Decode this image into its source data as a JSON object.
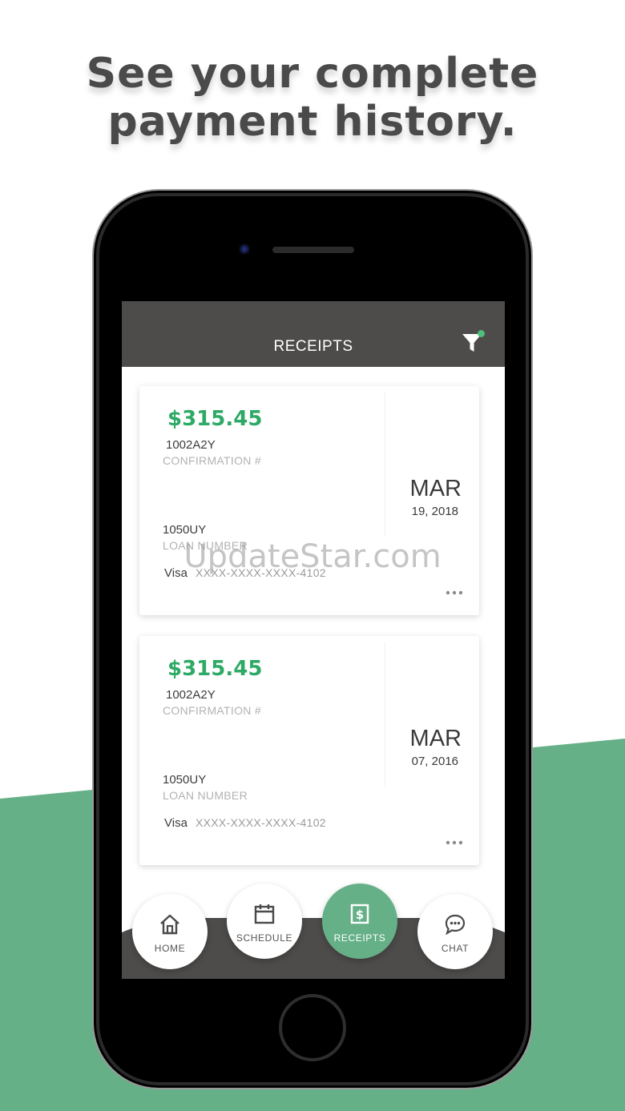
{
  "headline": {
    "line1": "See your complete",
    "line2": "payment history."
  },
  "header": {
    "title": "RECEIPTS"
  },
  "receipts": [
    {
      "amount": "$315.45",
      "confirmation": "1002A2Y",
      "confirmation_label": "CONFIRMATION #",
      "month": "MAR",
      "date": "19, 2018",
      "loan": "1050UY",
      "loan_label": "LOAN NUMBER",
      "card_type": "Visa",
      "card_number": "XXXX-XXXX-XXXX-4102"
    },
    {
      "amount": "$315.45",
      "confirmation": "1002A2Y",
      "confirmation_label": "CONFIRMATION #",
      "month": "MAR",
      "date": "07, 2016",
      "loan": "1050UY",
      "loan_label": "LOAN NUMBER",
      "card_type": "Visa",
      "card_number": "XXXX-XXXX-XXXX-4102"
    }
  ],
  "nav": {
    "home": "HOME",
    "schedule": "SCHEDULE",
    "receipts": "RECEIPTS",
    "chat": "CHAT"
  },
  "watermark": "UpdateStar.com",
  "colors": {
    "accent": "#66b088",
    "amount": "#2eaa66",
    "header": "#4e4c4a"
  }
}
